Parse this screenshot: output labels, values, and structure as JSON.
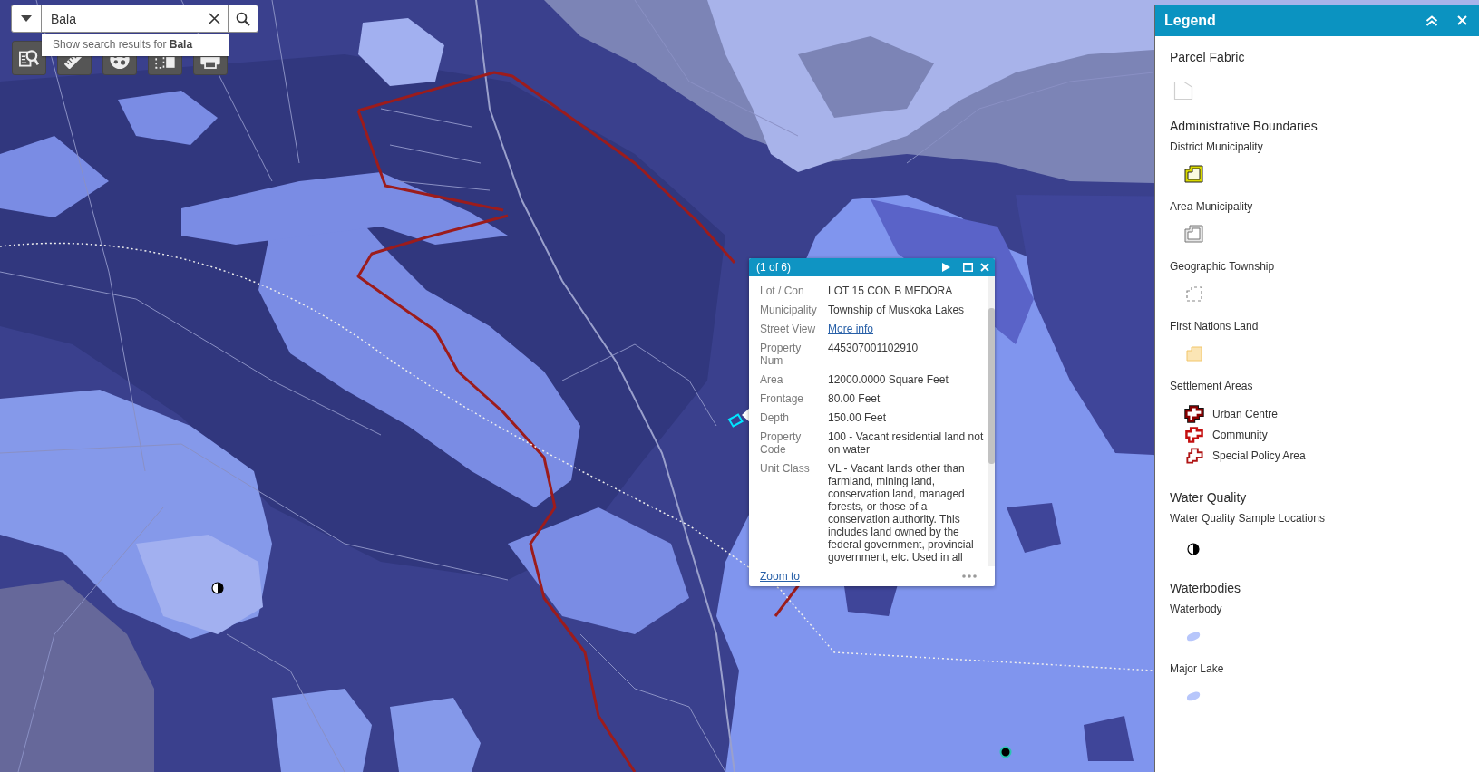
{
  "search": {
    "value": "Bala",
    "suggestion": "Show search results for **Bala**"
  },
  "popup": {
    "title": "(1 of 6)",
    "fields": [
      {
        "label": "Lot / Con",
        "value": "LOT 15 CON B MEDORA",
        "kind": "text"
      },
      {
        "label": "Municipality",
        "value": "Township of Muskoka Lakes",
        "kind": "text"
      },
      {
        "label": "Street View",
        "value": "More info",
        "kind": "link"
      },
      {
        "label": "Property Num",
        "value": "445307001102910",
        "kind": "text"
      },
      {
        "label": "Area",
        "value": "12000.0000 Square Feet",
        "kind": "text"
      },
      {
        "label": "Frontage",
        "value": "80.00 Feet",
        "kind": "text"
      },
      {
        "label": "Depth",
        "value": "150.00 Feet",
        "kind": "text"
      },
      {
        "label": "Property Code",
        "value": "100 - Vacant residential land not on water",
        "kind": "text"
      },
      {
        "label": "Unit Class",
        "value": "VL - Vacant lands other than farmland, mining land, conservation land, managed forests, or those of a conservation authority. This includes land owned by the federal government, provincial government, etc. Used in all",
        "kind": "text"
      }
    ],
    "footer_link": "Zoom to"
  },
  "legend": {
    "title": "Legend",
    "layers": [
      {
        "title": "Parcel Fabric",
        "groups": [
          {
            "symbols": [
              {
                "kind": "parcel"
              }
            ]
          }
        ]
      },
      {
        "title": "Administrative Boundaries",
        "groups": [
          {
            "name": "District Municipality",
            "symbols": [
              {
                "kind": "district"
              }
            ]
          },
          {
            "name": "Area Municipality",
            "symbols": [
              {
                "kind": "area"
              }
            ]
          },
          {
            "name": "Geographic Township",
            "symbols": [
              {
                "kind": "township"
              }
            ]
          },
          {
            "name": "First Nations Land",
            "symbols": [
              {
                "kind": "first-nations"
              }
            ]
          },
          {
            "name": "Settlement Areas",
            "symbols": [
              {
                "kind": "urban",
                "label": "Urban Centre"
              },
              {
                "kind": "community",
                "label": "Community"
              },
              {
                "kind": "special",
                "label": "Special Policy Area"
              }
            ]
          }
        ]
      },
      {
        "title": "Water Quality",
        "groups": [
          {
            "name": "Water Quality Sample Locations",
            "symbols": [
              {
                "kind": "sample"
              }
            ]
          }
        ]
      },
      {
        "title": "Waterbodies",
        "groups": [
          {
            "name": "Waterbody",
            "symbols": [
              {
                "kind": "water"
              }
            ]
          },
          {
            "name": "Major Lake",
            "symbols": [
              {
                "kind": "water"
              }
            ]
          }
        ]
      }
    ]
  }
}
